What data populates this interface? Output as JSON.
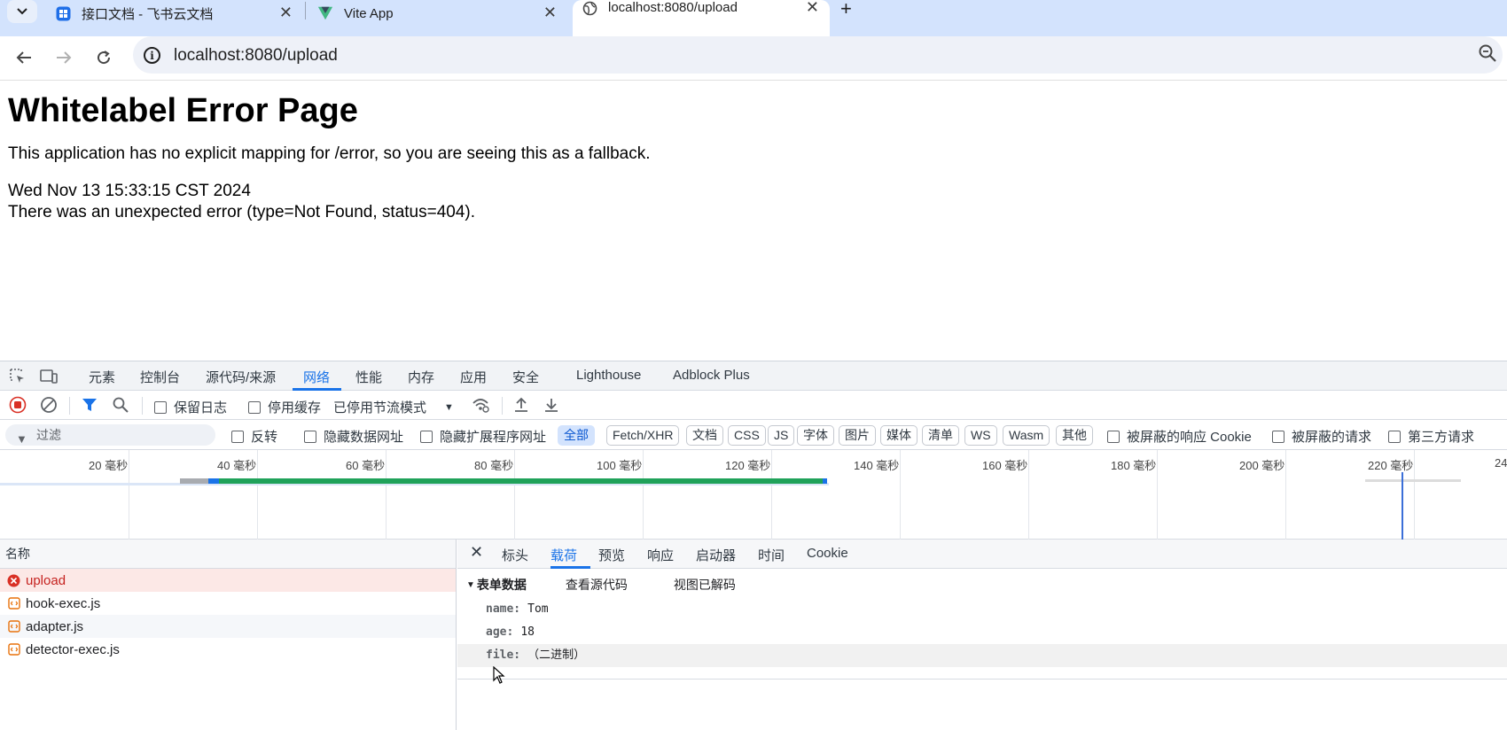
{
  "browser": {
    "tabs": [
      {
        "title": "接口文档 - 飞书云文档",
        "icon": "feishu-doc-icon"
      },
      {
        "title": "Vite App",
        "icon": "vite-icon"
      },
      {
        "title": "localhost:8080/upload",
        "icon": "globe-icon",
        "active": true
      }
    ],
    "url": "localhost:8080/upload"
  },
  "page": {
    "heading": "Whitelabel Error Page",
    "message": "This application has no explicit mapping for /error, so you are seeing this as a fallback.",
    "timestamp": "Wed Nov 13 15:33:15 CST 2024",
    "error": "There was an unexpected error (type=Not Found, status=404)."
  },
  "devtools": {
    "tabs": [
      "元素",
      "控制台",
      "源代码/来源",
      "网络",
      "性能",
      "内存",
      "应用",
      "安全",
      "Lighthouse",
      "Adblock Plus"
    ],
    "active_tab": "网络",
    "toolbar": {
      "preserve_log": "保留日志",
      "disable_cache": "停用缓存",
      "throttling": "已停用节流模式"
    },
    "filter": {
      "placeholder": "过滤",
      "invert": "反转",
      "hide_data_urls": "隐藏数据网址",
      "hide_ext_urls": "隐藏扩展程序网址",
      "types": [
        "全部",
        "Fetch/XHR",
        "文档",
        "CSS",
        "JS",
        "字体",
        "图片",
        "媒体",
        "清单",
        "WS",
        "Wasm",
        "其他"
      ],
      "blocked_cookies": "被屏蔽的响应 Cookie",
      "blocked_requests": "被屏蔽的请求",
      "third_party": "第三方请求"
    },
    "timeline": {
      "ticks": [
        "20 毫秒",
        "40 毫秒",
        "60 毫秒",
        "80 毫秒",
        "100 毫秒",
        "120 毫秒",
        "140 毫秒",
        "160 毫秒",
        "180 毫秒",
        "200 毫秒",
        "220 毫秒",
        "24"
      ]
    },
    "requests": {
      "column": "名称",
      "rows": [
        {
          "name": "upload",
          "status": "error"
        },
        {
          "name": "hook-exec.js",
          "status": "script"
        },
        {
          "name": "adapter.js",
          "status": "script"
        },
        {
          "name": "detector-exec.js",
          "status": "script"
        }
      ]
    },
    "detail": {
      "tabs": [
        "标头",
        "载荷",
        "预览",
        "响应",
        "启动器",
        "时间",
        "Cookie"
      ],
      "active_tab": "载荷",
      "section_title": "表单数据",
      "view_source": "查看源代码",
      "view_decoded": "视图已解码",
      "fields": [
        {
          "key": "name:",
          "value": "Tom"
        },
        {
          "key": "age:",
          "value": "18"
        },
        {
          "key": "file:",
          "value": "（二进制）"
        }
      ]
    }
  }
}
